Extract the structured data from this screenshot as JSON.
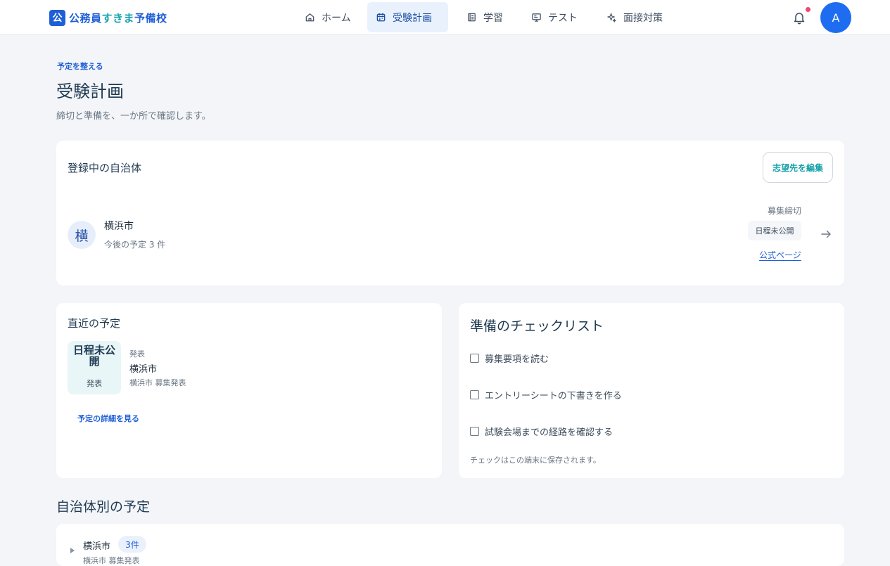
{
  "app": {
    "logo_mark": "公",
    "logo_name_part1": "公務員",
    "logo_name_part2": "すきま",
    "logo_name_part3": "予備校"
  },
  "nav": {
    "items": [
      {
        "label": "ホーム",
        "icon": "home-icon"
      },
      {
        "label": "受験計画",
        "icon": "calendar-icon",
        "active": true
      },
      {
        "label": "学習",
        "icon": "notebook-icon"
      },
      {
        "label": "テスト",
        "icon": "monitor-icon"
      },
      {
        "label": "面接対策",
        "icon": "sparkle-icon"
      }
    ]
  },
  "user": {
    "avatar_initial": "A",
    "notification_dot_color": "#f0486a"
  },
  "page": {
    "eyebrow": "予定を整える",
    "title": "受験計画",
    "description": "締切と準備を、一か所で確認します。"
  },
  "registered": {
    "heading": "登録中の自治体",
    "edit_button": "志望先を編集",
    "municipality": {
      "avatar_char": "横",
      "name": "横浜市",
      "upcoming": "今後の予定 3 件",
      "deadline_label": "募集締切",
      "deadline_value": "日程未公開",
      "official_link": "公式ページ"
    }
  },
  "upcoming": {
    "heading": "直近の予定",
    "event": {
      "date": "日程未公開",
      "date_sub": "発表",
      "type": "発表",
      "name": "横浜市",
      "description": "横浜市 募集発表"
    },
    "detail_link": "予定の詳細を見る"
  },
  "checklist": {
    "heading": "準備のチェックリスト",
    "items": [
      {
        "label": "募集要項を読む",
        "checked": false
      },
      {
        "label": "エントリーシートの下書きを作る",
        "checked": false
      },
      {
        "label": "試験会場までの経路を確認する",
        "checked": false
      }
    ],
    "note": "チェックはこの端末に保存されます。"
  },
  "by_municipality": {
    "heading": "自治体別の予定",
    "rows": [
      {
        "name": "横浜市",
        "count": "3件",
        "sub": "横浜市 募集発表"
      }
    ]
  },
  "colors": {
    "brand": "#1e5fd8",
    "teal": "#14a0a8",
    "background": "#f3f5f8"
  }
}
